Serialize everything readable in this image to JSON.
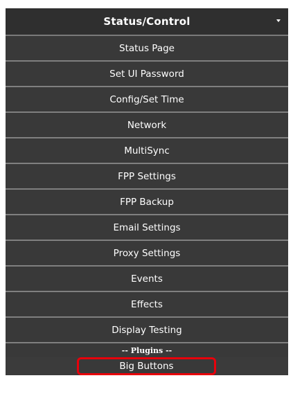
{
  "menu": {
    "title": "Status/Control",
    "dropdown_icon": "caret-down-icon",
    "items": [
      {
        "label": "Status Page"
      },
      {
        "label": "Set UI Password"
      },
      {
        "label": "Config/Set Time"
      },
      {
        "label": "Network"
      },
      {
        "label": "MultiSync"
      },
      {
        "label": "FPP Settings"
      },
      {
        "label": "FPP Backup"
      },
      {
        "label": "Email Settings"
      },
      {
        "label": "Proxy Settings"
      },
      {
        "label": "Events"
      },
      {
        "label": "Effects"
      },
      {
        "label": "Display Testing"
      }
    ],
    "divider_label": "-- Plugins --",
    "plugins": [
      {
        "label": "Big Buttons"
      }
    ]
  },
  "colors": {
    "menu_background": "#393939",
    "header_background": "#2f2f2f",
    "separator": "#808080",
    "text": "#ffffff",
    "highlight_outline": "#e8000b"
  }
}
